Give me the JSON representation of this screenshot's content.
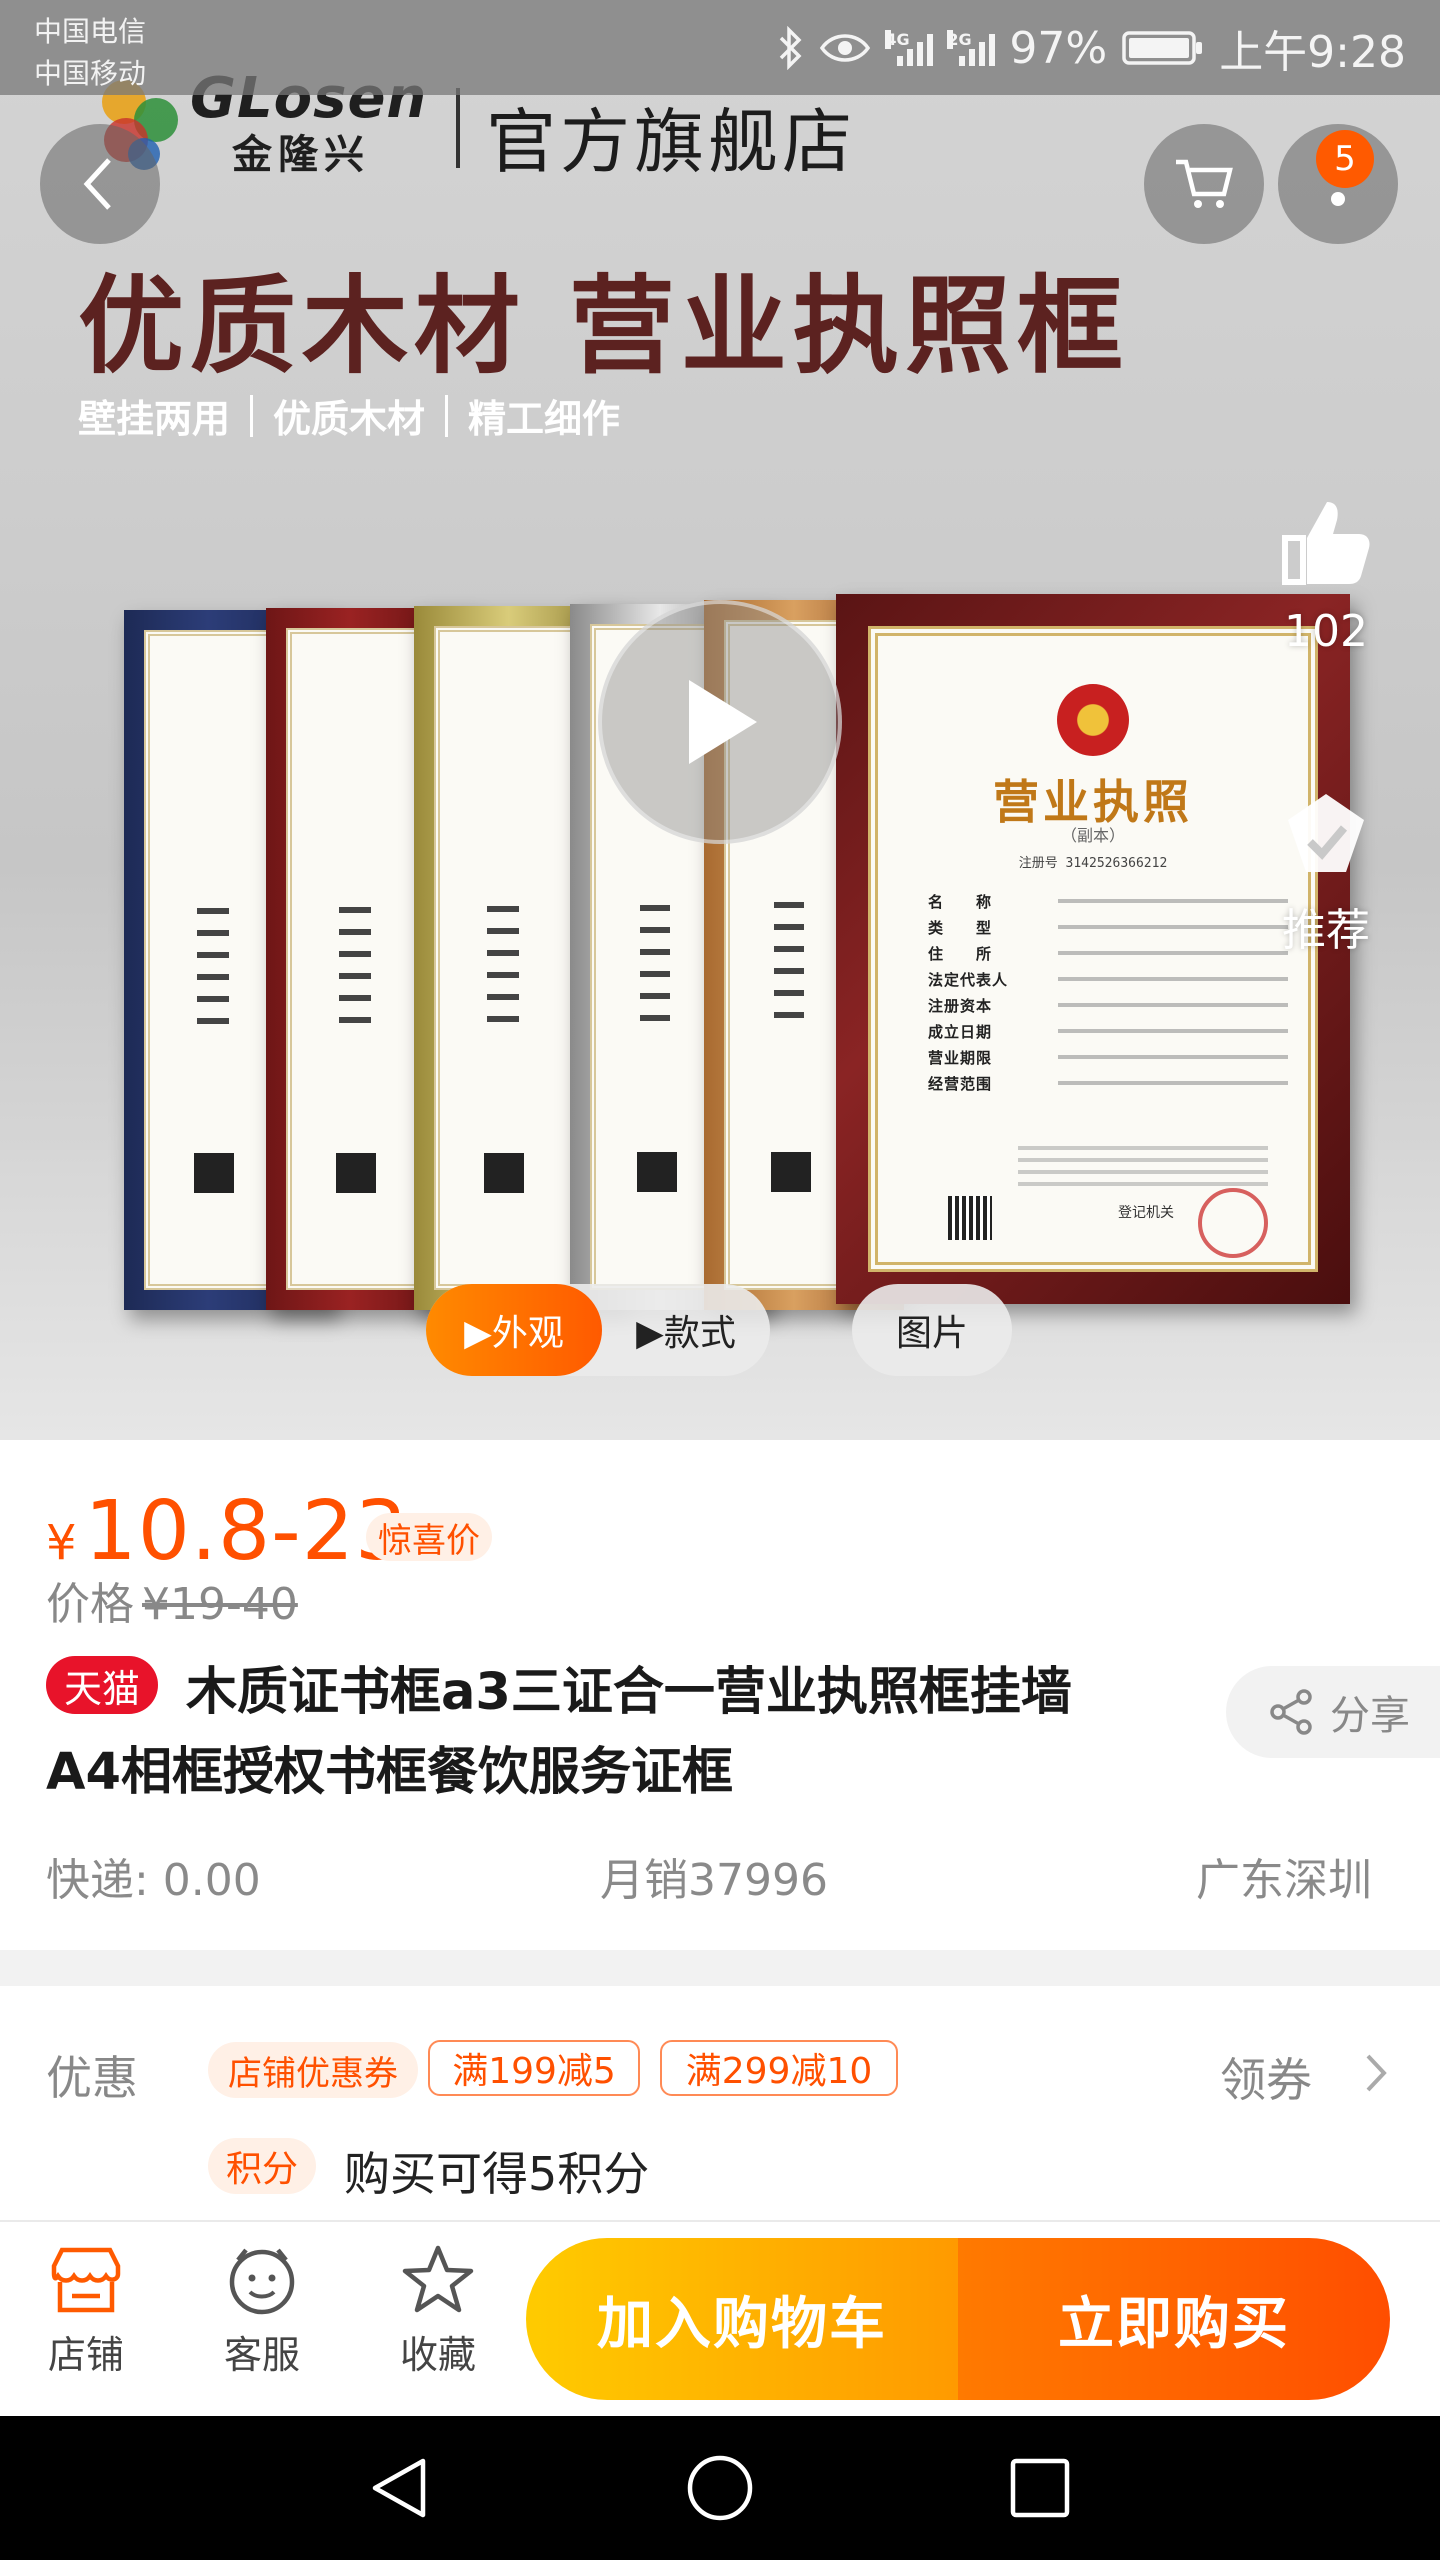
{
  "status_bar": {
    "carrier1": "中国电信",
    "carrier2": "中国移动",
    "net1": "4G",
    "net2": "2G",
    "battery": "97%",
    "time": "上午9:28"
  },
  "hero": {
    "brand_en": "GLosen",
    "brand_cn": "金隆兴",
    "store": "官方旗舰店",
    "headline": "优质木材 营业执照框",
    "features": [
      "壁挂两用",
      "优质木材",
      "精工细作"
    ],
    "cart_badge": "5",
    "like_count": "102",
    "recommend_label": "推荐",
    "certificate": {
      "title": "营业执照",
      "subtitle": "（副本）",
      "reg_no": "注册号 3142526366212",
      "fields": [
        "名　　称",
        "类　　型",
        "住　　所",
        "法定代表人",
        "注册资本",
        "成立日期",
        "营业期限",
        "经营范围"
      ],
      "issuer": "登记机关"
    },
    "media_tabs": [
      "▶外观",
      "▶款式",
      "图片"
    ]
  },
  "product": {
    "currency": "¥",
    "price": "10.8-23",
    "price_tag": "惊喜价",
    "orig_label": "价格",
    "orig_price": "¥19-40",
    "platform_badge": "天猫",
    "title_line1": "木质证书框a3三证合一营业执照框挂墙",
    "title_line2": "A4相框授权书框餐饮服务证框",
    "share_label": "分享",
    "shipping": "快递: 0.00",
    "monthly_sales": "月销37996",
    "location": "广东深圳"
  },
  "promotions": {
    "label": "优惠",
    "coupon_chip": "店铺优惠券",
    "discounts": [
      "满199减5",
      "满299减10"
    ],
    "claim_label": "领券",
    "points_chip": "积分",
    "points_text": "购买可得5积分"
  },
  "bottom_bar": {
    "store": "店铺",
    "service": "客服",
    "favorite": "收藏",
    "add_to_cart": "加入购物车",
    "buy_now": "立即购买"
  },
  "colors": {
    "accent": "#ff5000",
    "tmall_red": "#e8132a",
    "cart_yellow": "#ffcb00",
    "buy_orange": "#ff4e00"
  },
  "icons": {
    "back": "chevron-left-icon",
    "cart": "cart-icon",
    "more": "more-icon",
    "like": "thumbs-up-icon",
    "recommend": "recommend-icon",
    "play": "play-icon",
    "share": "share-icon",
    "store": "store-icon",
    "service": "service-icon",
    "favorite": "star-icon"
  }
}
